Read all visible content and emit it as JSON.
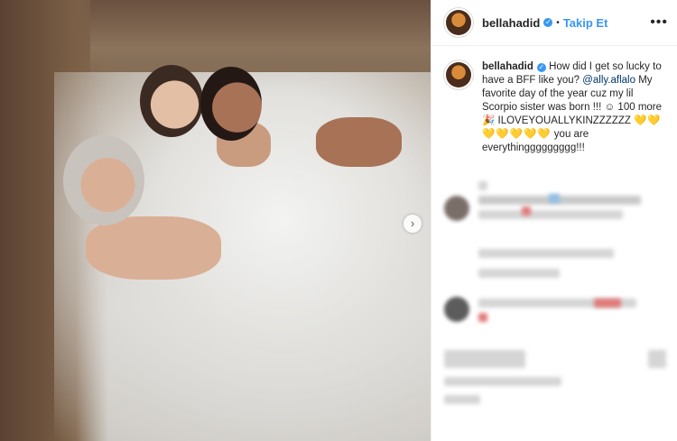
{
  "post": {
    "author": {
      "username": "bellahadid",
      "verified_badge": "✓",
      "follow_label": "Takip Et",
      "separator": "•"
    },
    "more_label": "•••",
    "caption": {
      "username": "bellahadid",
      "text_before": " How did I get so lucky to have a BFF like you? ",
      "mention": "@ally.aflalo",
      "text_after": " My favorite day of the year cuz my lil Scorpio sister was born !!! ☺ 100 more 🎉 ILOVEYOUALLYKINZZZZZZ ",
      "hearts": "💛💛💛💛💛💛💛",
      "text_end": " you are everythinggggggggg!!!"
    },
    "media": {
      "next_icon": "›"
    }
  },
  "icons": {
    "verified": "verified-badge-icon",
    "next": "chevron-right-icon",
    "more": "more-options-icon"
  },
  "colors": {
    "link": "#3897f0",
    "mention": "#003569",
    "text": "#262626"
  }
}
